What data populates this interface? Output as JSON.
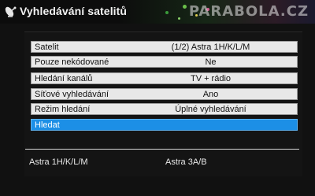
{
  "header": {
    "title": "Vyhledávání satelitů",
    "watermark": "PARABOLA.CZ"
  },
  "icons": {
    "header_icon": "satellite-dish-icon"
  },
  "colors": {
    "selected_row": "#1c8fe6",
    "row_background": "#e8e8e8",
    "screen_background": "#111111"
  },
  "menu": {
    "items": [
      {
        "label": "Satelit",
        "value": "(1/2) Astra 1H/K/L/M"
      },
      {
        "label": "Pouze nekódované",
        "value": "Ne"
      },
      {
        "label": "Hledání kanálů",
        "value": "TV + rádio"
      },
      {
        "label": "Síťové vyhledávání",
        "value": "Ano"
      },
      {
        "label": "Režim hledání",
        "value": "Úplné vyhledávání"
      },
      {
        "label": "Hledat",
        "value": ""
      }
    ],
    "selected_index": 5
  },
  "footer": {
    "satellites": [
      "Astra 1H/K/L/M",
      "Astra 3A/B"
    ]
  }
}
